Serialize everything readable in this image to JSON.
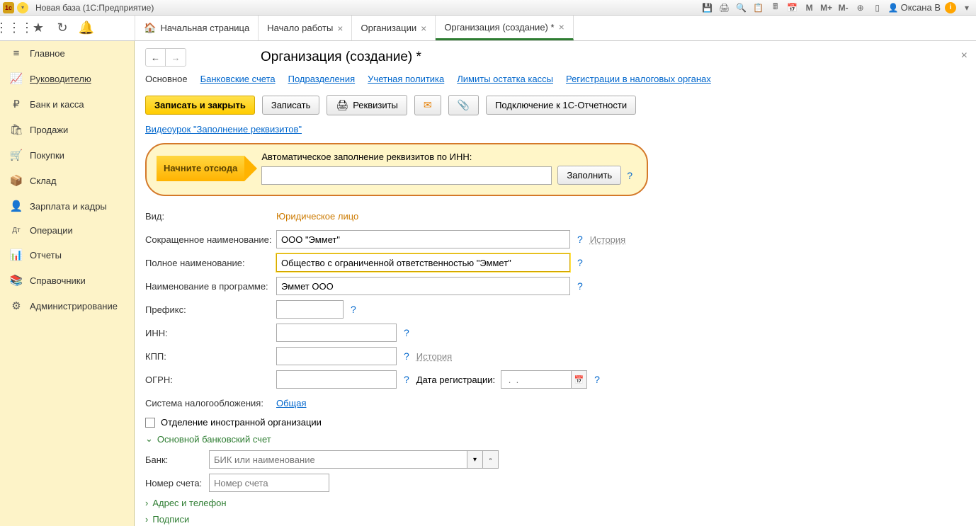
{
  "titlebar": {
    "title": "Новая база   (1С:Предприятие)",
    "user": "Оксана В"
  },
  "tabs": {
    "home": "Начальная страница",
    "t1": "Начало работы",
    "t2": "Организации",
    "t3": "Организация (создание) *"
  },
  "sidebar": {
    "items": [
      {
        "icon": "≡",
        "label": "Главное"
      },
      {
        "icon": "📈",
        "label": "Руководителю"
      },
      {
        "icon": "₽",
        "label": "Банк и касса"
      },
      {
        "icon": "🛍",
        "label": "Продажи"
      },
      {
        "icon": "🛒",
        "label": "Покупки"
      },
      {
        "icon": "📦",
        "label": "Склад"
      },
      {
        "icon": "👤",
        "label": "Зарплата и кадры"
      },
      {
        "icon": "Дт",
        "label": "Операции"
      },
      {
        "icon": "📊",
        "label": "Отчеты"
      },
      {
        "icon": "📚",
        "label": "Справочники"
      },
      {
        "icon": "⚙",
        "label": "Администрирование"
      }
    ]
  },
  "page": {
    "title": "Организация (создание) *"
  },
  "subnav": {
    "main": "Основное",
    "bank": "Банковские счета",
    "dept": "Подразделения",
    "policy": "Учетная политика",
    "limits": "Лимиты остатка кассы",
    "tax": "Регистрации в налоговых органах"
  },
  "actions": {
    "save_close": "Записать и закрыть",
    "save": "Записать",
    "props": "Реквизиты",
    "connect": "Подключение к 1С-Отчетности"
  },
  "video_link": "Видеоурок \"Заполнение реквизитов\"",
  "hint": {
    "start": "Начните отсюда",
    "label": "Автоматическое заполнение реквизитов по ИНН:",
    "fill": "Заполнить"
  },
  "form": {
    "type_label": "Вид:",
    "type_value": "Юридическое лицо",
    "short_label": "Сокращенное наименование:",
    "short_value": "ООО \"Эммет\"",
    "full_label": "Полное наименование:",
    "full_value": "Общество с ограниченной ответственностью \"Эммет\"",
    "prog_label": "Наименование в программе:",
    "prog_value": "Эммет ООО",
    "prefix_label": "Префикс:",
    "inn_label": "ИНН:",
    "kpp_label": "КПП:",
    "ogrn_label": "ОГРН:",
    "regdate_label": "Дата регистрации:",
    "regdate_placeholder": " .  .    ",
    "tax_label": "Система налогообложения:",
    "tax_value": "Общая",
    "foreign_label": "Отделение иностранной организации",
    "bank_section": "Основной банковский счет",
    "bank_label": "Банк:",
    "bank_placeholder": "БИК или наименование",
    "acct_label": "Номер счета:",
    "acct_placeholder": "Номер счета",
    "addr_section": "Адрес и телефон",
    "sign_section": "Подписи",
    "history": "История"
  }
}
